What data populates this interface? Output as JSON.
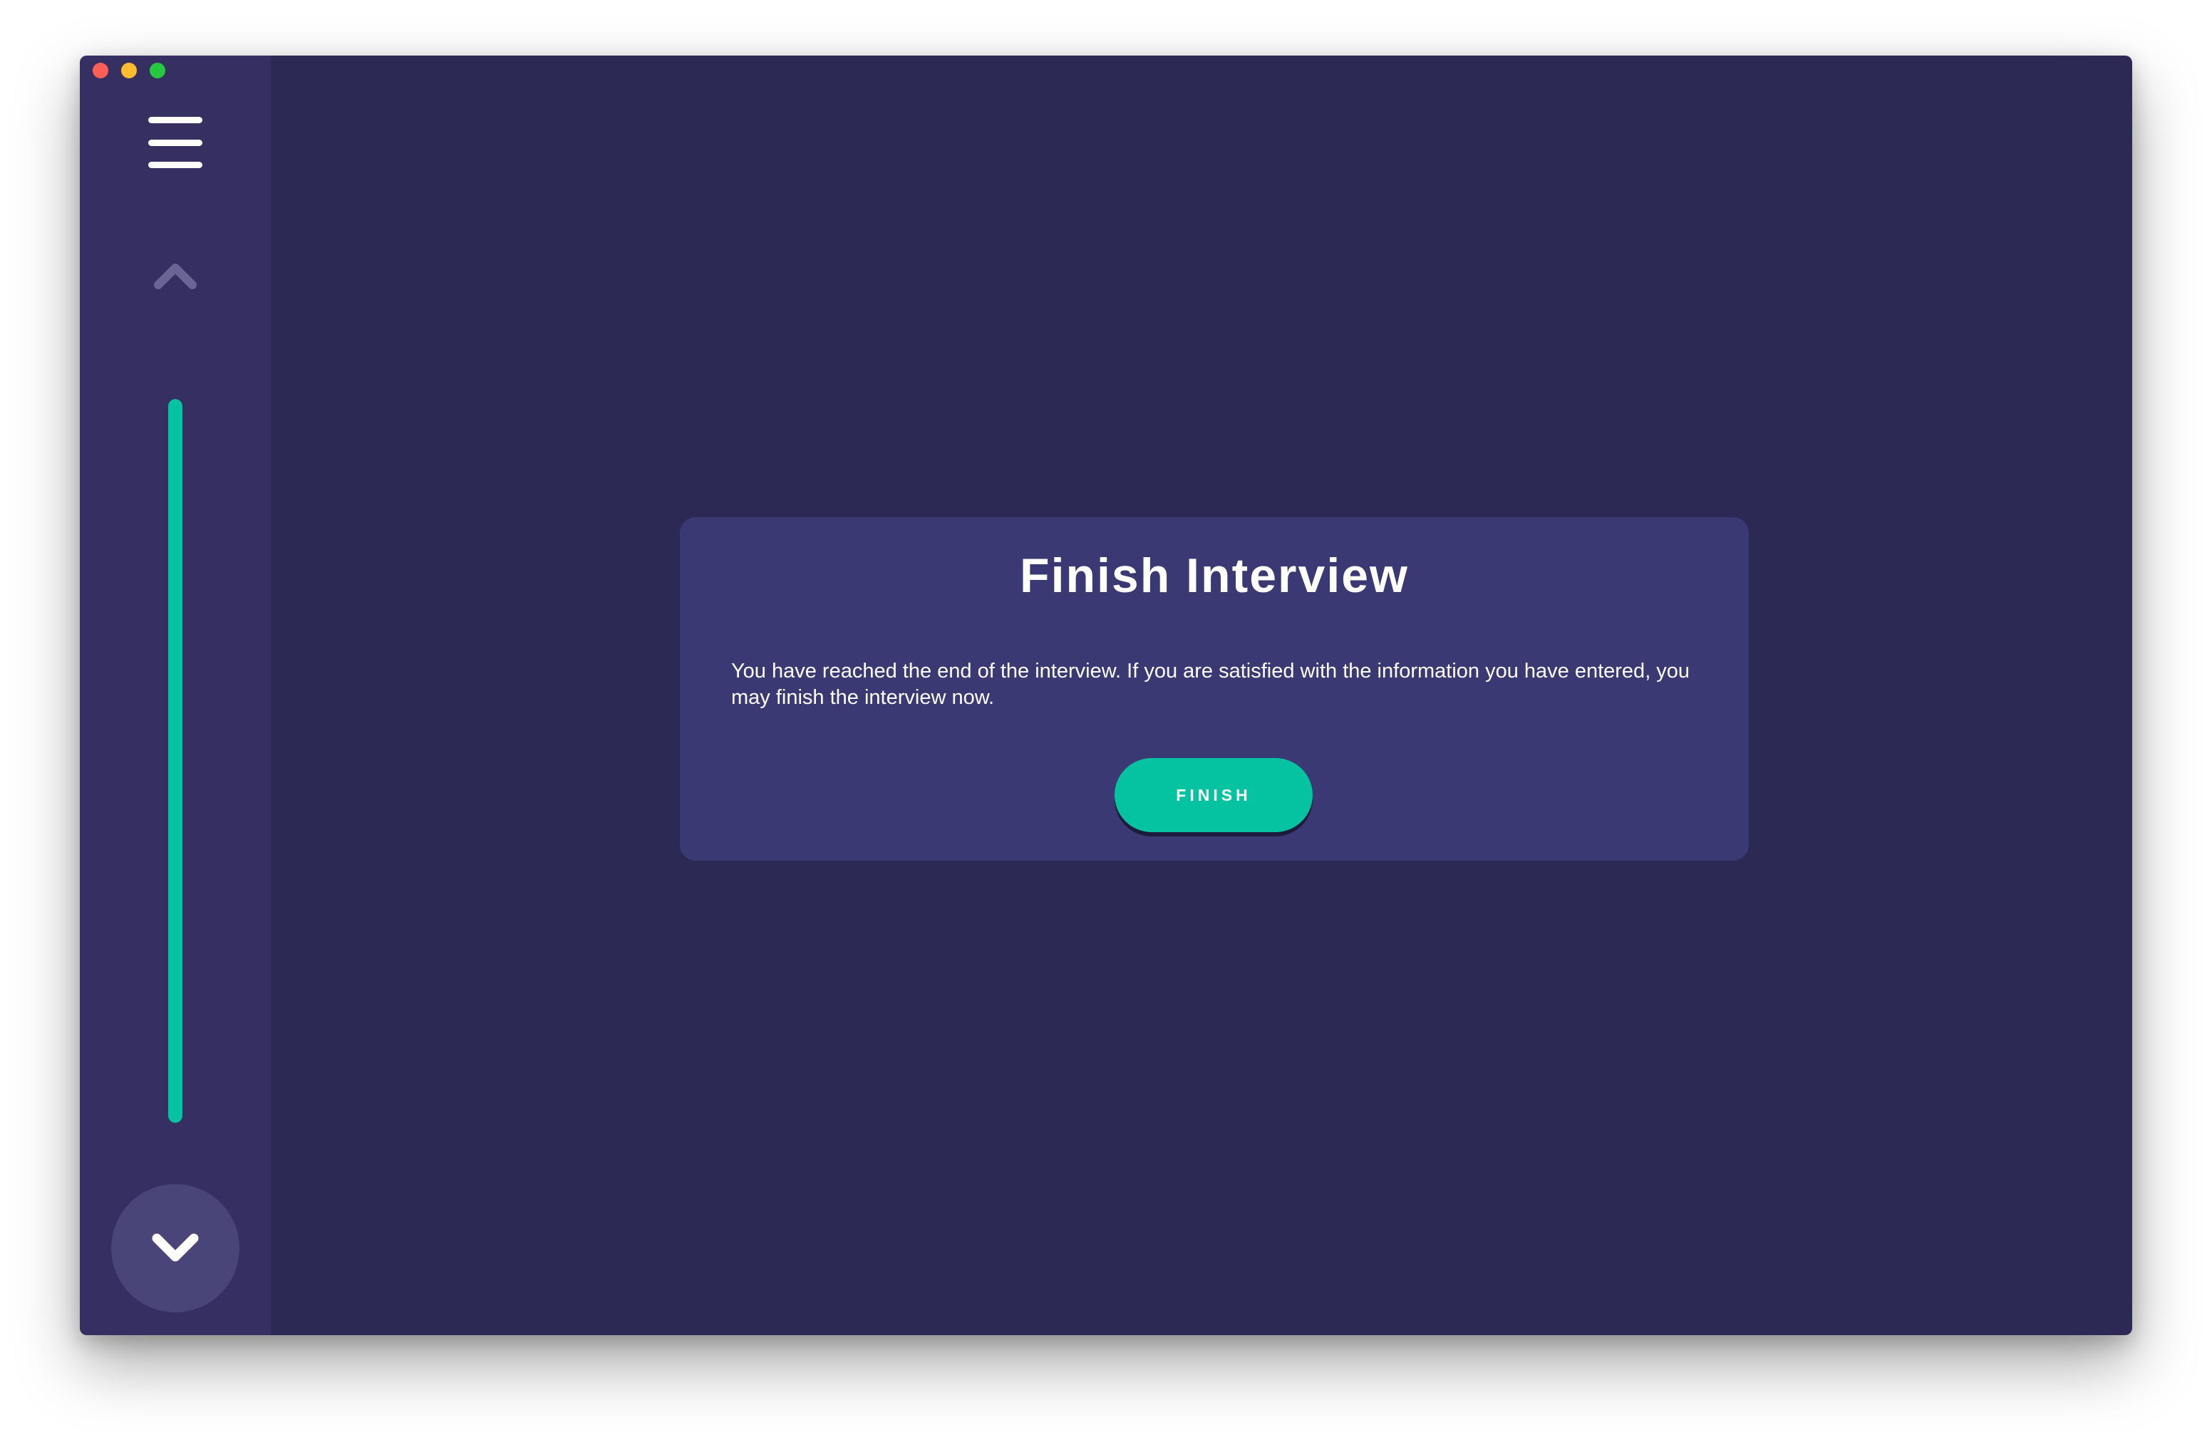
{
  "window": {
    "controls": [
      {
        "name": "close",
        "color": "#ff5f57"
      },
      {
        "name": "minimize",
        "color": "#febc2e"
      },
      {
        "name": "maximize",
        "color": "#28c840"
      }
    ]
  },
  "sidebar": {
    "menu_icon": "hamburger-menu-icon",
    "up_icon": "chevron-up-icon",
    "down_icon": "chevron-down-icon",
    "progress_fraction": 1.0,
    "progress_color": "#05c3a0"
  },
  "card": {
    "title": "Finish Interview",
    "body": "You have reached the end of the interview. If you are satisfied with the information you have entered, you may finish the interview now.",
    "button_label": "FINISH",
    "button_color": "#05c3a0"
  },
  "colors": {
    "background": "#2c2a54",
    "sidebar": "#353061",
    "card": "#3b3973",
    "accent": "#05c3a0"
  }
}
